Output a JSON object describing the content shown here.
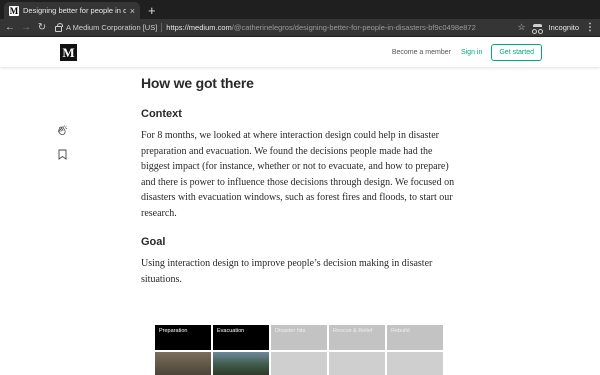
{
  "browser": {
    "tab_title": "Designing better for people in disasters",
    "tab_favicon": "M",
    "tab_close": "×",
    "new_tab": "+",
    "org": "A Medium Corporation [US]",
    "url_host": "https://medium.com",
    "url_path": "/@catherinelegros/designing-better-for-people-in-disasters-bf9c0498e872",
    "incognito_label": "Incognito",
    "icons": [
      "back-arrow-icon",
      "forward-arrow-icon",
      "reload-icon",
      "lock-icon",
      "star-icon",
      "incognito-icon",
      "menu-icon"
    ]
  },
  "medium_header": {
    "logo": "M",
    "become_member": "Become a member",
    "sign_in": "Sign in",
    "get_started": "Get started",
    "accent_color": "#03a87c"
  },
  "article": {
    "heading": "How we got there",
    "context_heading": "Context",
    "context_text": "For 8 months, we looked at where interaction design could help in disaster preparation and evacuation. We found the decisions people made had the biggest impact (for instance, whether or not to evacuate, and how to prepare) and there is power to influence those decisions through design. We focused on disasters with evacuation windows, such as forest fires and floods, to start our research.",
    "goal_heading": "Goal",
    "goal_text": "Using interaction design to improve people’s decision making in disaster situations."
  },
  "image_grid": {
    "labels": [
      "Preparation",
      "Evacuation",
      "Disaster hits",
      "Rescue & Relief",
      "Rebuild"
    ]
  }
}
